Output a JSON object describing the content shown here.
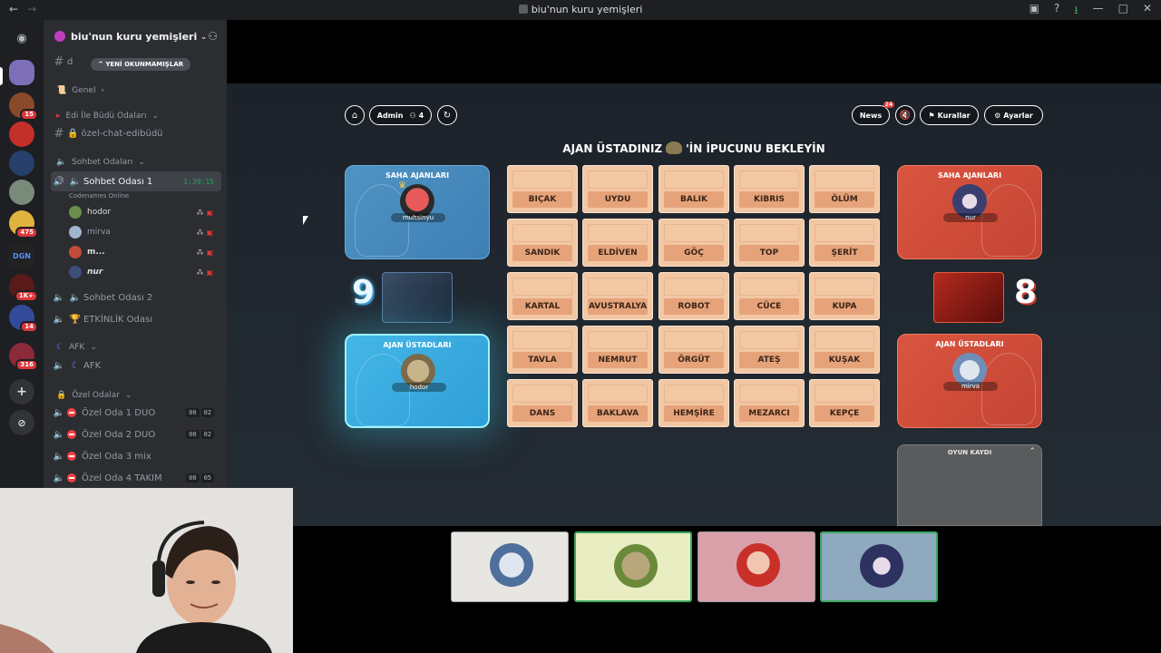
{
  "window": {
    "title": "biu'nun kuru yemişleri"
  },
  "server_rail": {
    "badges": [
      "15",
      "475",
      "1K+",
      "14",
      "316"
    ],
    "dgn_label": "DGN"
  },
  "sidebar": {
    "server_name": "biu'nun kuru yemişleri",
    "unread_pill": "YENİ OKUNMAMIŞLAR",
    "first_channel_partial": "d",
    "genel": "Genel",
    "edi_category": "Edi İle Büdü Odaları",
    "edi_channel": "özel-chat-edibüdü",
    "sohbet_category": "Sohbet Odaları",
    "voice1": {
      "name": "Sohbet Odası 1",
      "timer": "1:39:15",
      "status": "Codenames Online"
    },
    "voice_users": [
      {
        "name": "hodor"
      },
      {
        "name": "mirva"
      },
      {
        "name": "m..."
      },
      {
        "name": "nur"
      }
    ],
    "voice2": "Sohbet Odası 2",
    "etkinlik": "ETKİNLİK Odası",
    "afk_category": "AFK",
    "afk_channel": "AFK",
    "ozel_category": "Özel Odalar",
    "ozel_rooms": [
      {
        "name": "Özel Oda 1 DUO",
        "c1": "00",
        "c2": "02"
      },
      {
        "name": "Özel Oda 2 DUO",
        "c1": "00",
        "c2": "02"
      },
      {
        "name": "Özel Oda 3 mix",
        "c1": "",
        "c2": ""
      },
      {
        "name": "Özel Oda 4 TAKIM",
        "c1": "00",
        "c2": "05"
      }
    ]
  },
  "game": {
    "toolbar": {
      "admin_label": "Admin",
      "player_count": "4",
      "news_label": "News",
      "news_count": "24",
      "rules_label": "Kurallar",
      "settings_label": "Ayarlar"
    },
    "status_prefix": "AJAN ÜSTADINIZ",
    "status_suffix": "'İN İPUCUNU BEKLEYİN",
    "blue": {
      "field_title": "SAHA AJANLARI",
      "field_player": "muhsinyu",
      "spymaster_title": "AJAN ÜSTADLARI",
      "spymaster_player": "hodor",
      "score": "9"
    },
    "red": {
      "field_title": "SAHA AJANLARI",
      "field_player": "nur",
      "spymaster_title": "AJAN ÜSTADLARI",
      "spymaster_player": "mirva",
      "score": "8"
    },
    "cards": [
      "BIÇAK",
      "UYDU",
      "BALIK",
      "KIBRIS",
      "ÖLÜM",
      "SANDIK",
      "ELDİVEN",
      "GÖÇ",
      "TOP",
      "ŞERİT",
      "KARTAL",
      "AVUSTRALYA",
      "ROBOT",
      "CÜCE",
      "KUPA",
      "TAVLA",
      "NEMRUT",
      "ÖRGÜT",
      "ATEŞ",
      "KUŞAK",
      "DANS",
      "BAKLAVA",
      "HEMŞİRE",
      "MEZARCI",
      "KEPÇE"
    ],
    "log_title": "OYUN KAYDI"
  },
  "colors": {
    "blue_team": "#3fa6dc",
    "red_team": "#d9553f",
    "card": "#f2c7a4",
    "discord_green": "#23a55a"
  }
}
